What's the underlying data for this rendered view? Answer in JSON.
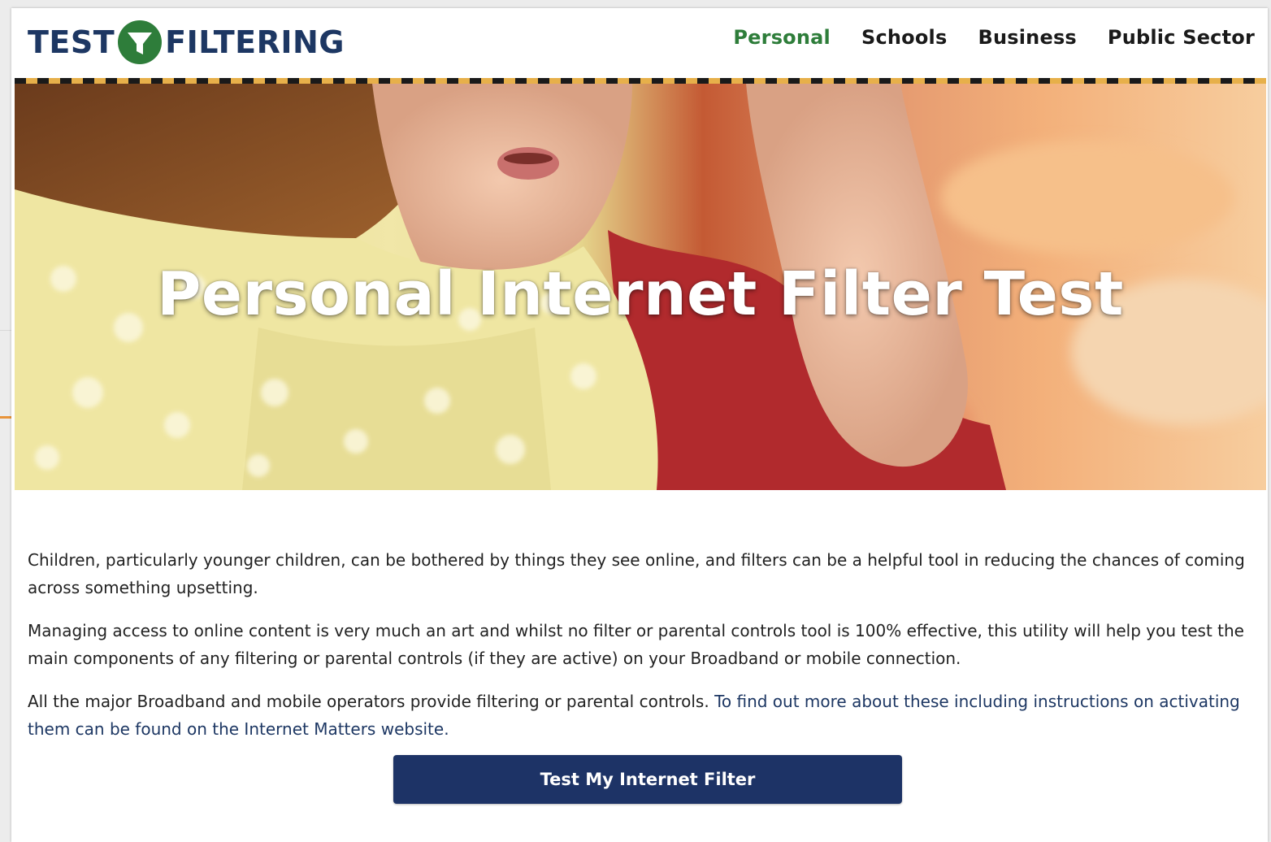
{
  "brand": {
    "logo_left": "TEST",
    "logo_right": "FILTERING",
    "logo_color": "#1d3763",
    "logo_mark_color": "#2e7d3a"
  },
  "nav": {
    "items": [
      {
        "label": "Personal",
        "active": true
      },
      {
        "label": "Schools",
        "active": false
      },
      {
        "label": "Business",
        "active": false
      },
      {
        "label": "Public Sector",
        "active": false
      }
    ],
    "active_color": "#2e7d3a"
  },
  "hero": {
    "title": "Personal Internet Filter Test"
  },
  "content": {
    "para1": "Children, particularly younger children, can be bothered by things they see online, and filters can be a helpful tool in reducing the chances of coming across something upsetting.",
    "para2": "Managing access to online content is very much an art and whilst no filter or parental controls tool is 100% effective, this utility will help you test the main components of any filtering or parental controls (if they are active) on your Broadband or mobile connection.",
    "para3_text": "All the major Broadband and mobile operators provide filtering or parental controls. ",
    "para3_link": "To find out more about these including instructions on activating them can be found on the Internet Matters website."
  },
  "cta": {
    "label": "Test My Internet Filter",
    "color": "#1d3366"
  }
}
